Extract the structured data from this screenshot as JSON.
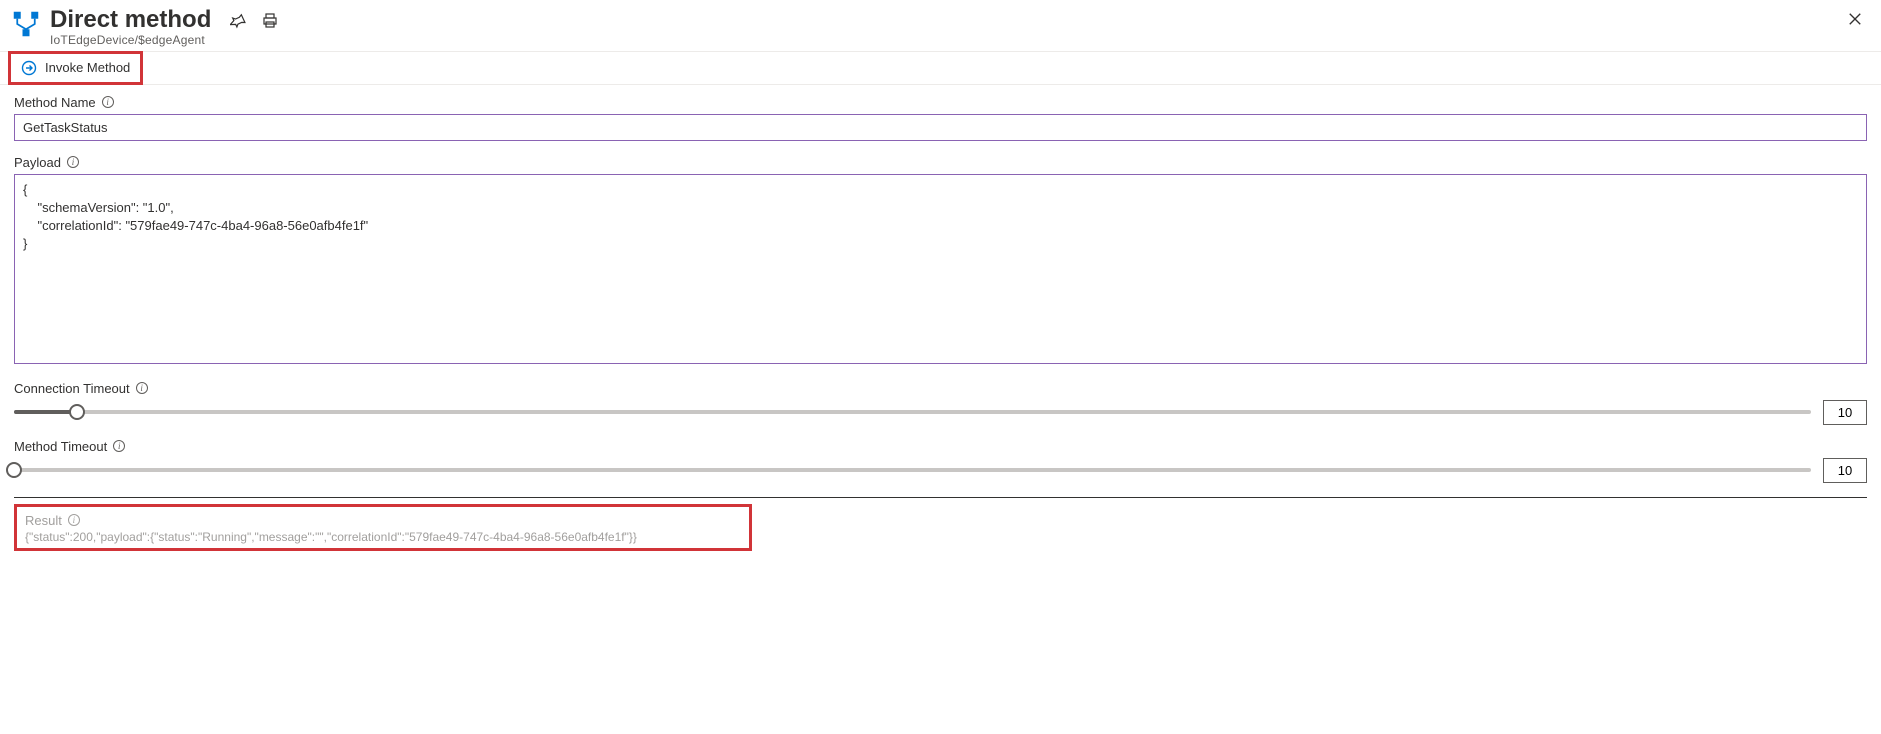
{
  "header": {
    "title": "Direct method",
    "subtitle": "IoTEdgeDevice/$edgeAgent"
  },
  "toolbar": {
    "invoke_label": "Invoke Method"
  },
  "fields": {
    "method_name": {
      "label": "Method Name",
      "value": "GetTaskStatus"
    },
    "payload": {
      "label": "Payload",
      "value": "{\n    \"schemaVersion\": \"1.0\",\n    \"correlationId\": \"579fae49-747c-4ba4-96a8-56e0afb4fe1f\"\n}"
    },
    "connection_timeout": {
      "label": "Connection Timeout",
      "value": "10",
      "fill_percent": 3.5
    },
    "method_timeout": {
      "label": "Method Timeout",
      "value": "10",
      "fill_percent": 0
    }
  },
  "result": {
    "label": "Result",
    "value": "{\"status\":200,\"payload\":{\"status\":\"Running\",\"message\":\"\",\"correlationId\":\"579fae49-747c-4ba4-96a8-56e0afb4fe1f\"}}"
  }
}
